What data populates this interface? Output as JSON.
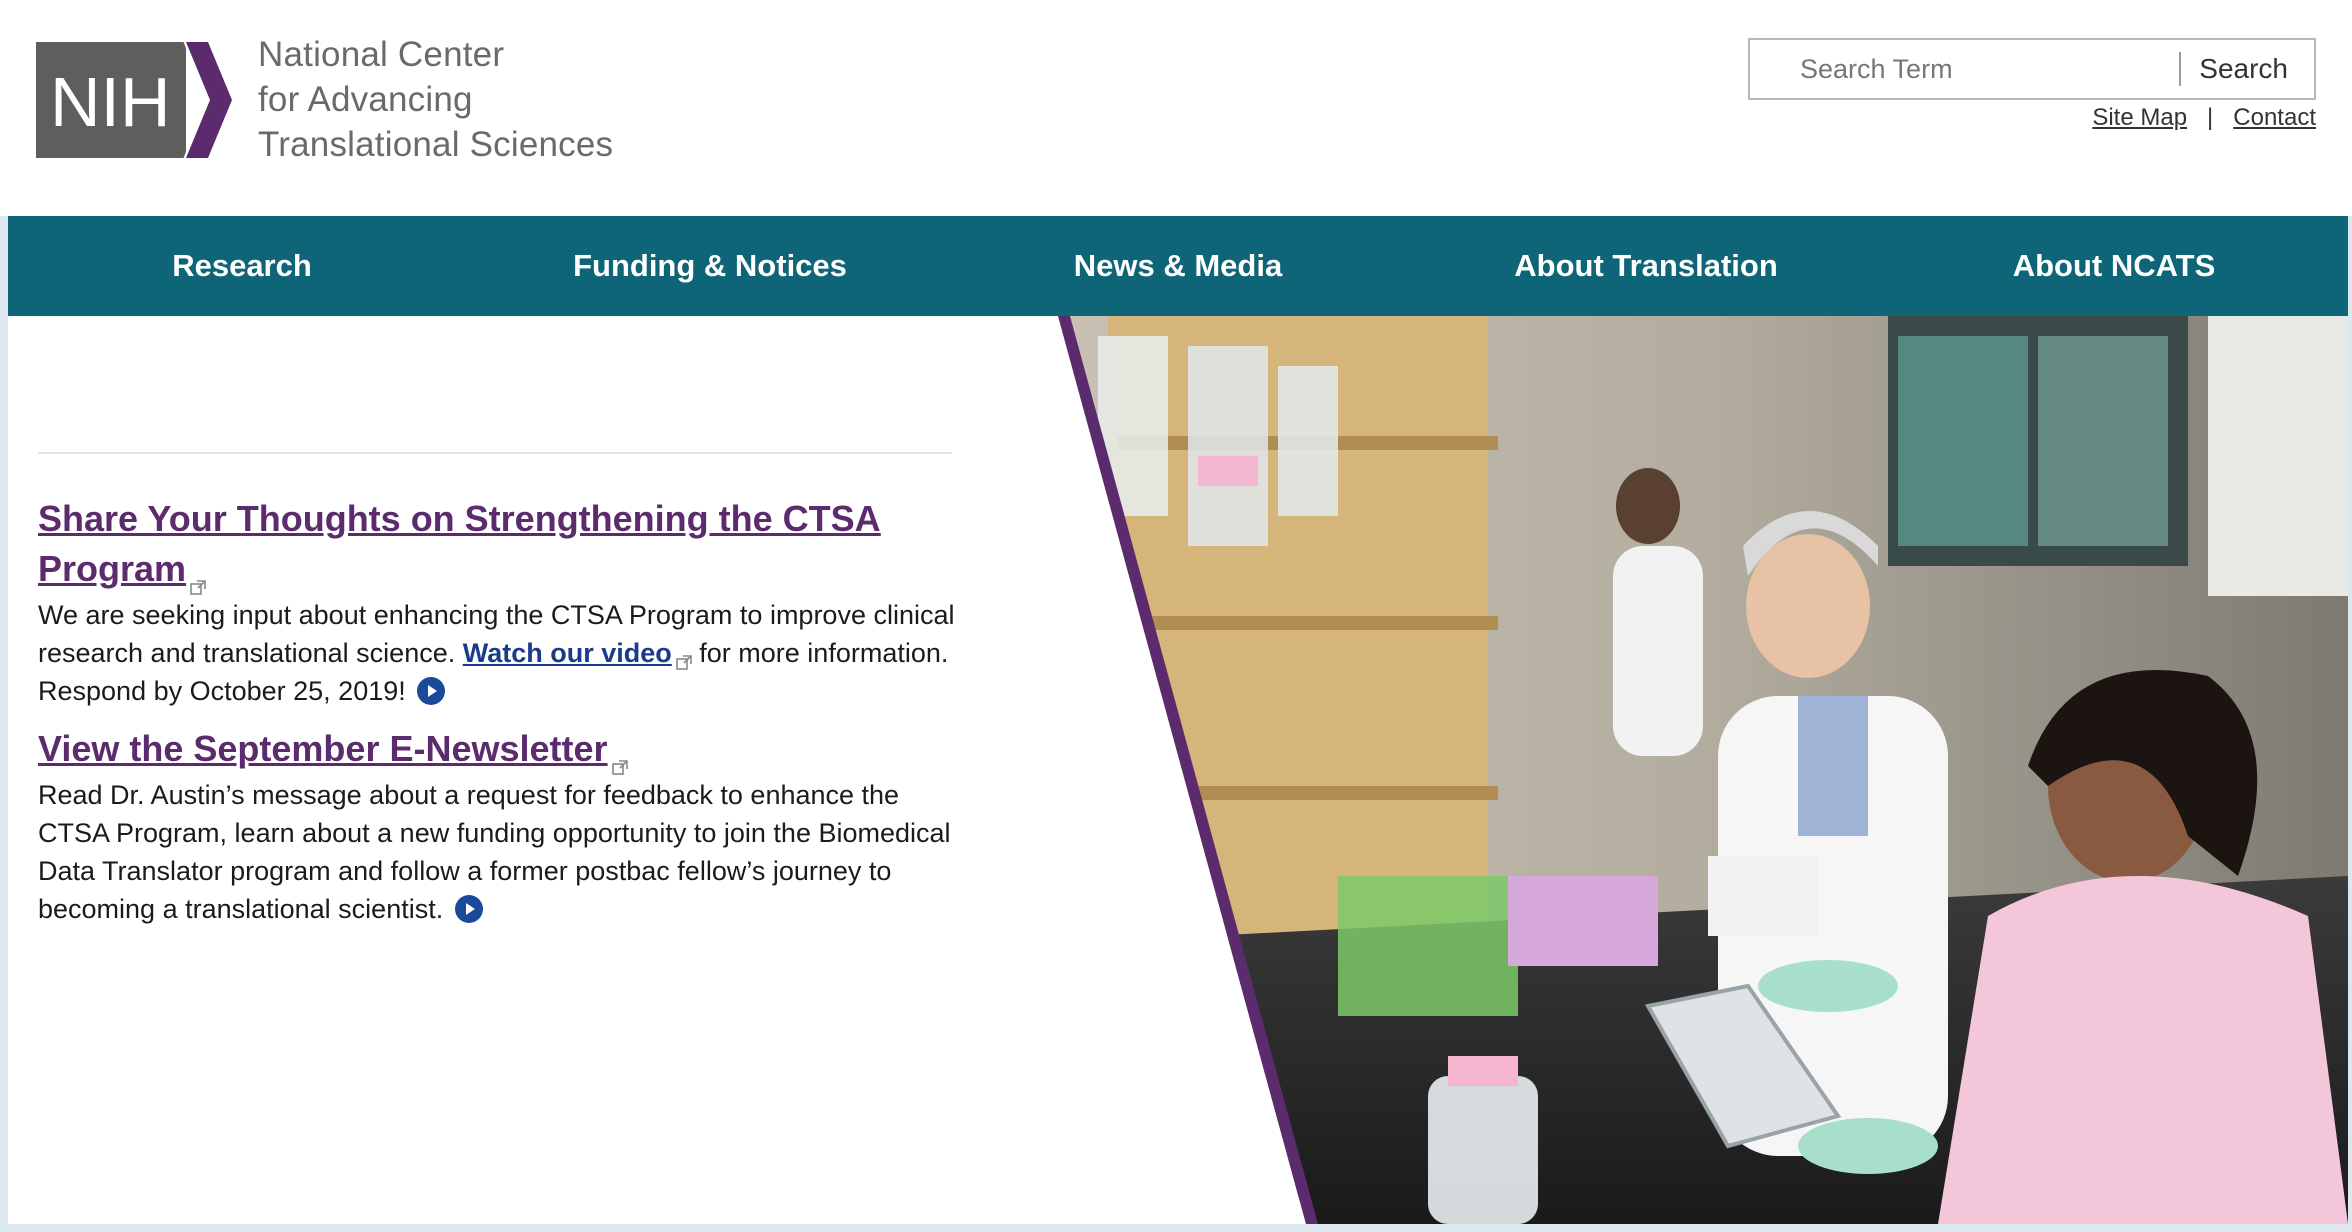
{
  "header": {
    "logo_text": "NIH",
    "center_name": [
      "National Center",
      "for Advancing",
      "Translational Sciences"
    ],
    "search": {
      "placeholder": "Search Term",
      "button_label": "Search"
    },
    "utility_links": [
      "Site Map",
      "Contact"
    ],
    "utility_separator": "|"
  },
  "nav": {
    "items": [
      "Research",
      "Funding & Notices",
      "News & Media",
      "About Translation",
      "About NCATS"
    ]
  },
  "stories": [
    {
      "title": "Share Your Thoughts on Strengthening the CTSA Program",
      "body_before": "We are seeking input about enhancing the CTSA Program to improve clinical research and translational science.",
      "link_text": "Watch our video",
      "body_after": "for more information. Respond by October 25, 2019!"
    },
    {
      "title": "View the September E-Newsletter",
      "body": "Read Dr. Austin’s message about a request for feedback to enhance the CTSA Program, learn about a new funding opportunity to join the Biomedical Data Translator program and follow a former postbac fellow’s journey to becoming a translational scientist."
    }
  ],
  "colors": {
    "nav_bg": "#0f6578",
    "headline": "#5b2b6e",
    "link": "#1a3a8a",
    "logo_gray": "#5e5e5e",
    "logo_purple": "#5b2b6e"
  },
  "icons": [
    "external-link-icon",
    "more-arrow-icon"
  ]
}
